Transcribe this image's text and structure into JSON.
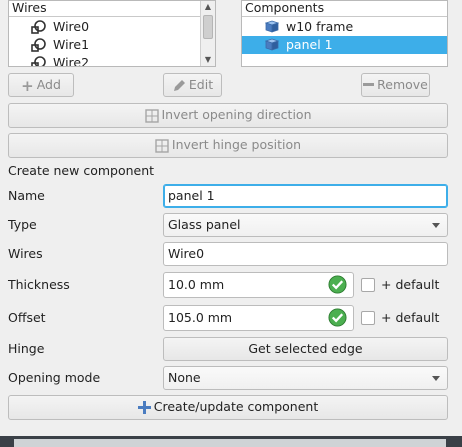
{
  "wires": {
    "header": "Wires",
    "items": [
      {
        "label": "Wire0",
        "icon": "wire-icon"
      },
      {
        "label": "Wire1",
        "icon": "wire-icon"
      },
      {
        "label": "Wire2",
        "icon": "wire-icon"
      }
    ]
  },
  "components": {
    "header": "Components",
    "items": [
      {
        "label": "w10 frame",
        "icon": "cube-icon",
        "selected": false
      },
      {
        "label": "panel 1",
        "icon": "cube-icon",
        "selected": true
      }
    ]
  },
  "toolbar": {
    "add_label": "Add",
    "edit_label": "Edit",
    "remove_label": "Remove",
    "invert_opening_label": "Invert opening direction",
    "invert_hinge_label": "Invert hinge position"
  },
  "form": {
    "section_title": "Create new component",
    "name_label": "Name",
    "name_value": "panel 1",
    "type_label": "Type",
    "type_value": "Glass panel",
    "wires_label": "Wires",
    "wires_value": "Wire0",
    "thickness_label": "Thickness",
    "thickness_value": "10.0 mm",
    "thickness_default_label": "+ default",
    "offset_label": "Offset",
    "offset_value": "105.0 mm",
    "offset_default_label": "+ default",
    "hinge_label": "Hinge",
    "hinge_button_label": "Get selected edge",
    "opening_mode_label": "Opening mode",
    "opening_mode_value": "None",
    "create_update_label": "Create/update component"
  },
  "colors": {
    "selection": "#3daee9",
    "valid_check": "#4caf50",
    "accent_icon": "#4a7cc0"
  }
}
